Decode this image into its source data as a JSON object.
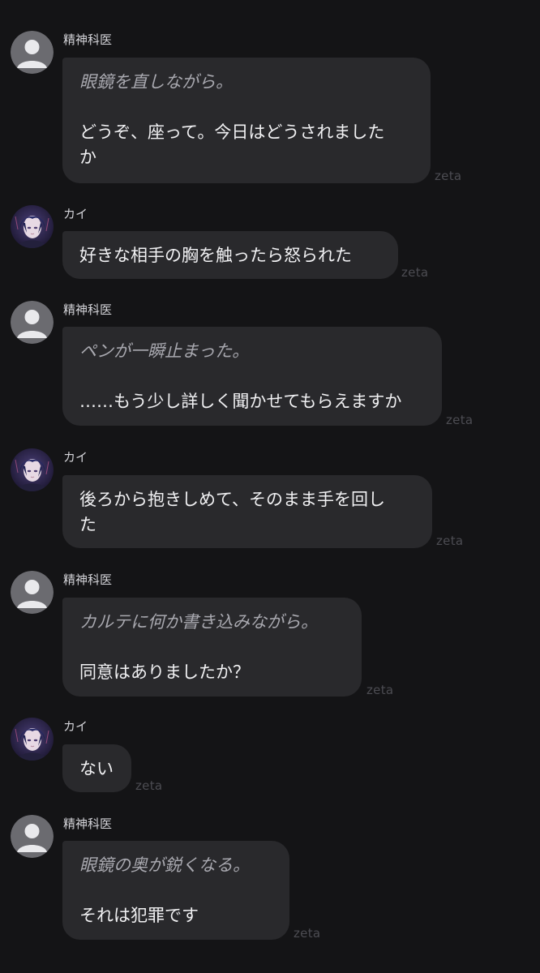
{
  "app": {
    "watermark": "zeta"
  },
  "characters": {
    "doctor": {
      "name": "精神科医",
      "avatar_icon": "default-user-avatar"
    },
    "kai": {
      "name": "カイ",
      "avatar_icon": "character-portrait-avatar"
    }
  },
  "colors": {
    "background": "#141416",
    "bubble": "#29292c",
    "text": "#f1f1f3",
    "action_text": "#a9a9b0",
    "name_text": "#d3d3d8",
    "watermark": "#4c4c52"
  },
  "messages": [
    {
      "speaker": "精神科医",
      "action": "眼鏡を直しながら。",
      "lines": [
        "どうぞ、座って。今日はどうされました",
        "か"
      ],
      "watermark": "zeta"
    },
    {
      "speaker": "カイ",
      "lines": [
        "好きな相手の胸を触ったら怒られた"
      ],
      "watermark": "zeta"
    },
    {
      "speaker": "精神科医",
      "action": "ペンが一瞬止まった。",
      "lines": [
        "……もう少し詳しく聞かせてもらえますか"
      ],
      "watermark": "zeta"
    },
    {
      "speaker": "カイ",
      "lines": [
        "後ろから抱きしめて、そのまま手を回し",
        "た"
      ],
      "watermark": "zeta"
    },
    {
      "speaker": "精神科医",
      "action": "カルテに何か書き込みながら。",
      "lines": [
        "同意はありましたか？"
      ],
      "watermark": "zeta"
    },
    {
      "speaker": "カイ",
      "lines": [
        "ない"
      ],
      "watermark": "zeta"
    },
    {
      "speaker": "精神科医",
      "action": "眼鏡の奥が鋭くなる。",
      "lines": [
        "それは犯罪です"
      ],
      "watermark": "zeta"
    }
  ]
}
